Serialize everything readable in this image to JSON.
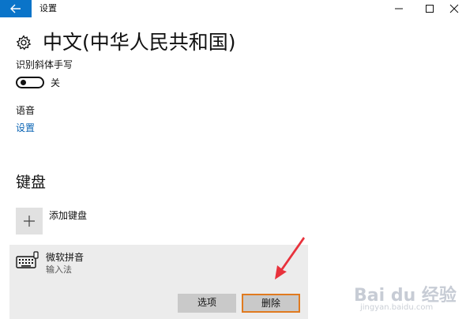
{
  "window": {
    "title": "设置",
    "back_icon": "arrow-left-icon",
    "controls": [
      "minimize-icon",
      "maximize-icon",
      "close-icon"
    ],
    "accent_color": "#0a74c9"
  },
  "header": {
    "icon": "gear-icon",
    "title": "中文(中华人民共和国)"
  },
  "handwriting": {
    "label": "识别斜体手写",
    "toggle_on": false,
    "toggle_state": "关"
  },
  "language": {
    "label": "语音",
    "settings_link": "设置",
    "link_color": "#0a64b4"
  },
  "keyboards": {
    "heading": "键盘",
    "add_label": "添加键盘",
    "add_icon": "plus-icon",
    "items": [
      {
        "name": "微软拼音",
        "type": "输入法",
        "icon": "keyboard-icon",
        "buttons": {
          "options": "选项",
          "remove": "删除"
        }
      }
    ]
  },
  "annotation": {
    "arrow_color": "#e8323c",
    "highlight_color": "#e07a1f"
  },
  "watermark": {
    "line1": "Bai du 经验",
    "line2": "jingyan.baidu.com"
  }
}
